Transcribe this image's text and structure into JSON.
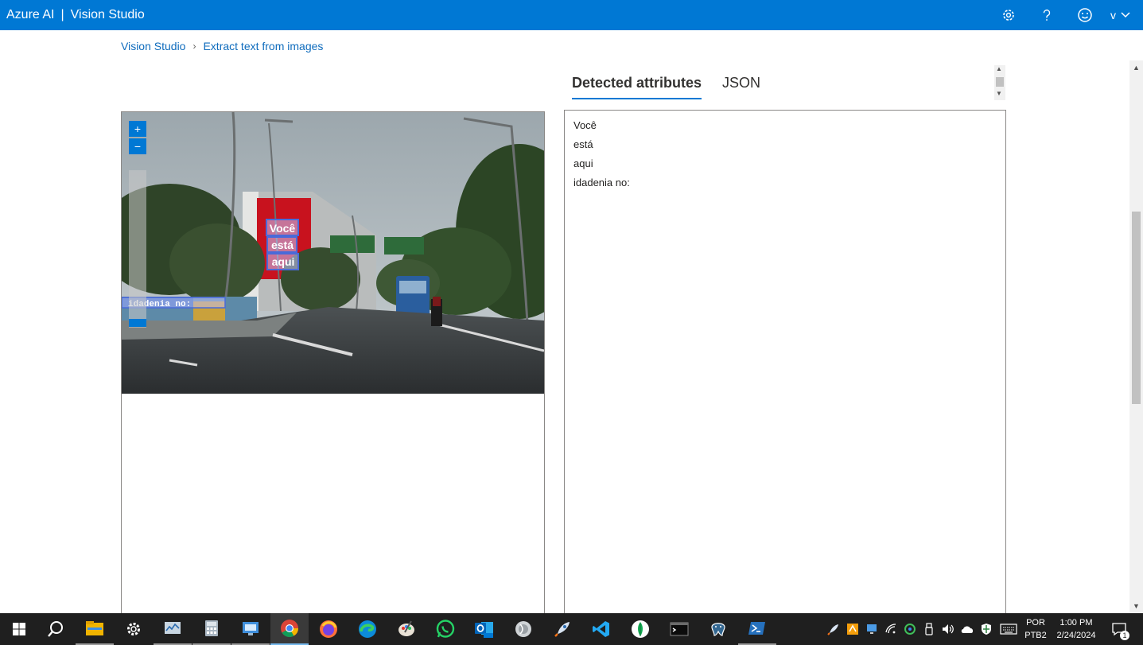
{
  "app": {
    "brand_left": "Azure AI",
    "brand_sep": "|",
    "brand_right": "Vision Studio",
    "user_initial": "v",
    "colors": {
      "accent": "#0078d4",
      "taskbar": "#1f1f1f"
    }
  },
  "topbar_icons": [
    "settings-icon",
    "help-icon",
    "feedback-smiley-icon"
  ],
  "breadcrumb": {
    "items": [
      "Vision Studio",
      "Extract text from images"
    ],
    "separator": "›"
  },
  "tabs": [
    {
      "label": "Detected attributes",
      "active": true
    },
    {
      "label": "JSON",
      "active": false
    }
  ],
  "image_panel": {
    "zoom_in": "+",
    "zoom_out": "−",
    "detected_words": [
      "Você",
      "está",
      "aqui"
    ],
    "sign_text": "idadenia no:"
  },
  "results": {
    "lines": [
      "Você",
      "está",
      "aqui",
      "idadenia no:"
    ]
  },
  "taskbar": {
    "apps": [
      "start-icon",
      "search-icon",
      "file-explorer-icon",
      "settings-icon",
      "task-manager-icon",
      "calculator-icon",
      "remote-desktop-icon",
      "chrome-icon",
      "firefox-icon",
      "edge-icon",
      "paint-icon",
      "whatsapp-icon",
      "outlook-icon",
      "app-icon",
      "rocket-app-icon",
      "vscode-icon",
      "mongodb-icon",
      "terminal-icon",
      "postgresql-icon",
      "powershell-icon"
    ],
    "language": "POR",
    "layout": "PTB2",
    "time": "1:00 PM",
    "date": "2/24/2024",
    "notifications": "1"
  }
}
